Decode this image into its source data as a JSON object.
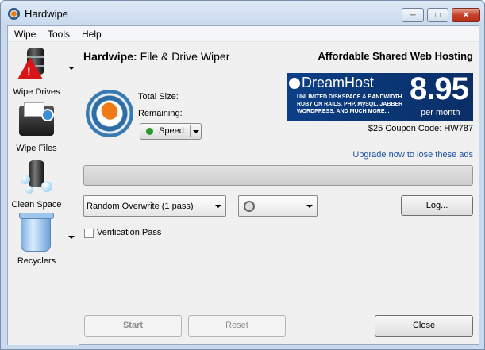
{
  "window": {
    "title": "Hardwipe",
    "controls": {
      "minimize": "─",
      "maximize": "□",
      "close": "✕"
    }
  },
  "menu": [
    "Wipe",
    "Tools",
    "Help"
  ],
  "sidebar": {
    "items": [
      {
        "label": "Wipe Drives",
        "icon": "hard-drive-warning-icon",
        "has_dropdown": true
      },
      {
        "label": "Wipe Files",
        "icon": "files-wipe-icon",
        "has_dropdown": false
      },
      {
        "label": "Clean Space",
        "icon": "clean-space-icon",
        "has_dropdown": false
      },
      {
        "label": "Recyclers",
        "icon": "recycle-bin-icon",
        "has_dropdown": true
      }
    ]
  },
  "header": {
    "app_name": "Hardwipe:",
    "subtitle": "File & Drive Wiper"
  },
  "ad": {
    "heading": "Affordable Shared Web Hosting",
    "brand": "DreamHost",
    "fine_print": "UNLIMITED DISKSPACE & BANDWIDTH RUBY ON RAILS, PHP, MySQL, JABBER WORDPRESS, AND MUCH MORE...",
    "price": "8.95",
    "per": "per month",
    "coupon": "$25 Coupon Code: HW787",
    "upgrade_link": "Upgrade now to lose these ads"
  },
  "status": {
    "total_size_label": "Total Size:",
    "remaining_label": "Remaining:",
    "speed_label": "Speed:",
    "speed_color": "#2b9a2b"
  },
  "progress": {
    "value": 0
  },
  "options": {
    "method": "Random Overwrite (1 pass)",
    "shutdown_icon": "power-icon",
    "log_button": "Log...",
    "verification_label": "Verification Pass",
    "verification_checked": false
  },
  "buttons": {
    "start": "Start",
    "reset": "Reset",
    "close": "Close"
  }
}
